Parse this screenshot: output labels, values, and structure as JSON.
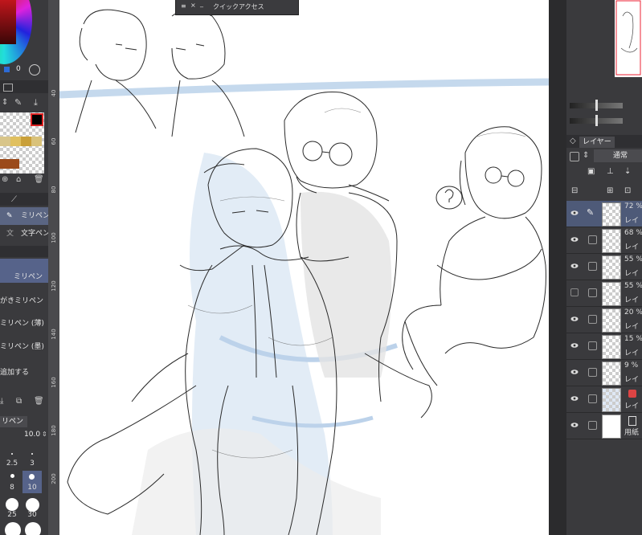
{
  "quick_access": {
    "title": "クイックアクセス",
    "close": "×",
    "min": "_"
  },
  "ruler": {
    "ticks": [
      "40",
      "60",
      "80",
      "100",
      "120",
      "140",
      "160",
      "180",
      "200"
    ]
  },
  "left_panel": {
    "color_value": "0",
    "tools": [
      {
        "label": "ミリペン",
        "selected": true
      },
      {
        "label": "文字ペン",
        "selected": false
      }
    ],
    "sub_tool_selected": "ミリペン",
    "brush_list": [
      "がきミリペン",
      "ミリペン (薄)",
      "ミリペン (墨)"
    ],
    "add_label": "追加する",
    "brush_tab": "リペン",
    "brush_size_value": "10.0",
    "sizes": [
      "2.5",
      "3",
      "8",
      "10",
      "25",
      "30"
    ]
  },
  "right_panel": {
    "tab_label": "レイヤー",
    "blend_mode": "通常",
    "layers": [
      {
        "opacity": "72 %",
        "name": "レイ",
        "visible": true,
        "selected": true,
        "pen_icon": true
      },
      {
        "opacity": "68 %",
        "name": "レイ",
        "visible": true,
        "selected": false
      },
      {
        "opacity": "55 %",
        "name": "レイ",
        "visible": true,
        "selected": false
      },
      {
        "opacity": "55 %",
        "name": "レイ",
        "visible": false,
        "selected": false
      },
      {
        "opacity": "20 %",
        "name": "レイ",
        "visible": true,
        "selected": false
      },
      {
        "opacity": "15 %",
        "name": "レイ",
        "visible": true,
        "selected": false
      },
      {
        "opacity": "9 %",
        "name": "レイ",
        "visible": true,
        "selected": false
      },
      {
        "opacity": "",
        "name": "レイ",
        "visible": true,
        "selected": false
      },
      {
        "opacity": "",
        "name": "用紙",
        "visible": true,
        "selected": false
      }
    ]
  },
  "colors": {
    "panel": "#3a3a3d",
    "selected_layer": "#4e5a78",
    "accent_blue": "#2d6bd6",
    "sketch_blue": "#b7cfe9"
  }
}
